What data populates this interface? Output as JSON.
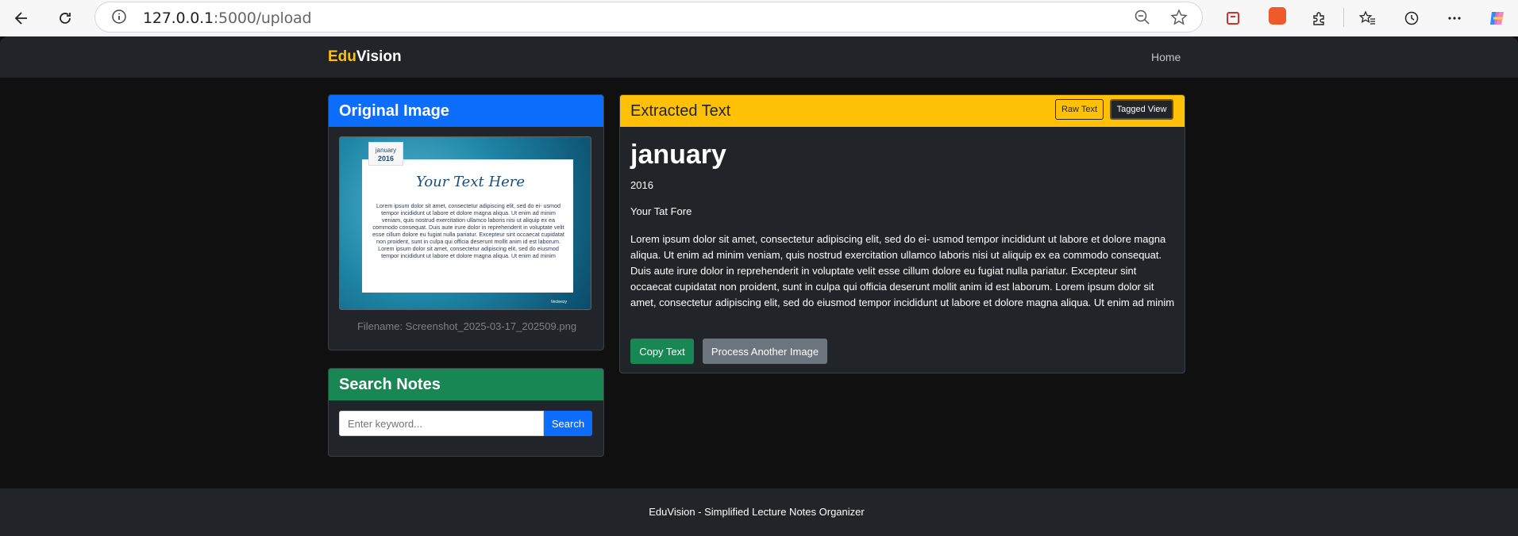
{
  "browser": {
    "url_host": "127.0.0.1",
    "url_rest": ":5000/upload",
    "icons": [
      "back-arrow-icon",
      "refresh-icon",
      "info-icon",
      "zoom-out-icon",
      "favorite-star-icon",
      "shield-extension-icon",
      "extension-app-icon",
      "puzzle-extensions-icon",
      "favorites-icon",
      "history-icon",
      "more-icon",
      "copilot-icon"
    ]
  },
  "navbar": {
    "brand_part1": "Edu",
    "brand_part2": "Vision",
    "home_link": "Home"
  },
  "original_card": {
    "title": "Original Image",
    "filename": "Filename: Screenshot_2025-03-17_202509.png",
    "thumbnail": {
      "month": "january",
      "year": "2016",
      "headline": "Your Text Here",
      "body": "Lorem ipsum dolor sit amet, consectetur adipiscing elit, sed do ei- usmod tempor incididunt ut labore et dolore magna aliqua. Ut enim ad minim veniam, quis nostrud exercitation ullamco laboris nisi ut aliquip ex ea commodo consequat. Duis aute irure dolor in reprehenderit in voluptate velit esse cillum dolore eu fugiat nulla pariatur. Excepteur sint occaecat cupidatat non proident, sunt in culpa qui officia deserunt mollit anim id est laborum. Lorem ipsum dolor sit amet, consectetur adipiscing elit, sed do eiusmod tempor incididunt ut labore et dolore magna aliqua. Ut enim ad minim",
      "credit": "Vecteezy"
    }
  },
  "search_card": {
    "title": "Search Notes",
    "placeholder": "Enter keyword...",
    "button": "Search"
  },
  "extracted_card": {
    "title": "Extracted Text",
    "raw_button": "Raw Text",
    "tagged_button": "Tagged View",
    "heading": "january",
    "year": "2016",
    "subheading": "Your Tat Fore",
    "body": "Lorem ipsum dolor sit amet, consectetur adipiscing elit, sed do ei- usmod tempor incididunt ut labore et dolore magna aliqua. Ut enim ad minim veniam, quis nostrud exercitation ullamco laboris nisi ut aliquip ex ea commodo consequat. Duis aute irure dolor in reprehenderit in voluptate velit esse cillum dolore eu fugiat nulla pariatur. Excepteur sint occaecat cupidatat non proident, sunt in culpa qui officia deserunt mollit anim id est laborum. Lorem ipsum dolor sit amet, consectetur adipiscing elit, sed do eiusmod tempor incididunt ut labore et dolore magna aliqua. Ut enim ad minim",
    "copy_button": "Copy Text",
    "process_button": "Process Another Image"
  },
  "footer": {
    "text": "EduVision - Simplified Lecture Notes Organizer"
  },
  "colors": {
    "brand_accent": "#ffc107",
    "primary": "#0d6efd",
    "success": "#198754",
    "secondary": "#6c757d",
    "dark": "#212529"
  }
}
